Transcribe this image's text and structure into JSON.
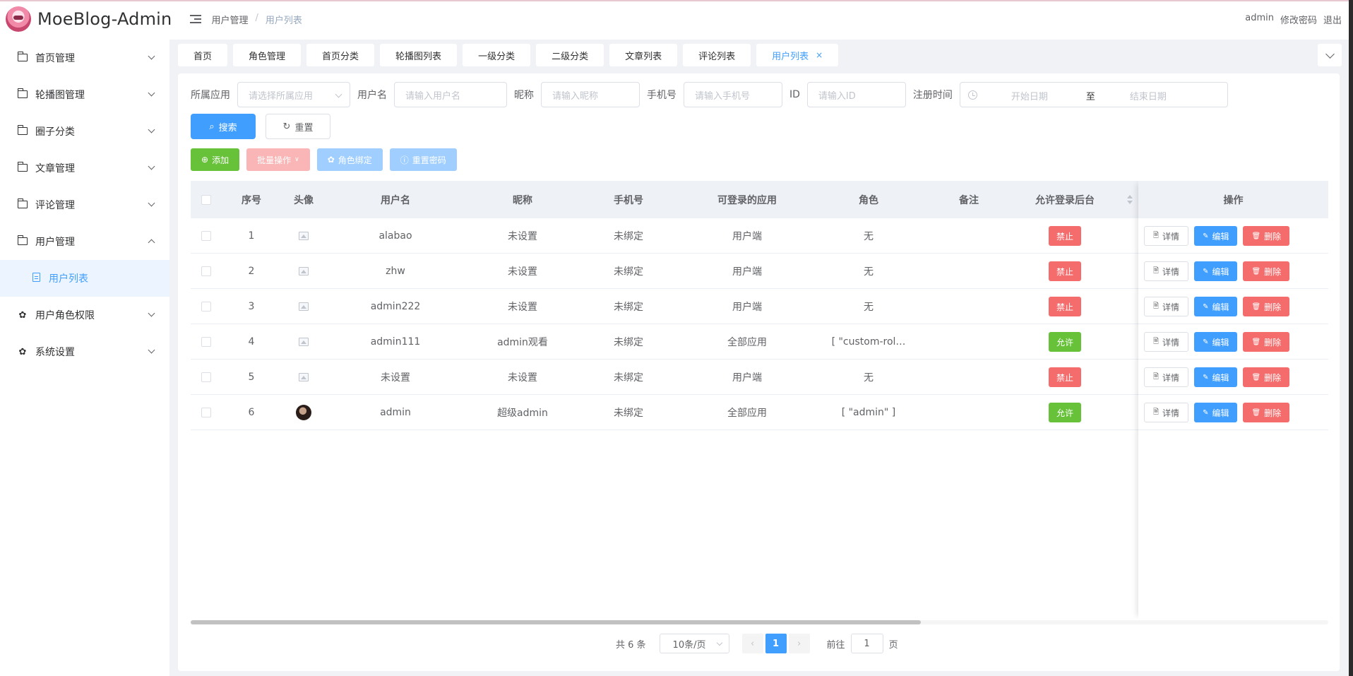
{
  "header": {
    "brand": "MoeBlog-Admin",
    "breadcrumb": [
      "用户管理",
      "用户列表"
    ],
    "user": "admin",
    "change_password": "修改密码",
    "logout": "退出"
  },
  "sidebar": {
    "items": [
      {
        "label": "首页管理",
        "icon": "folder-icon"
      },
      {
        "label": "轮播图管理",
        "icon": "folder-icon"
      },
      {
        "label": "圈子分类",
        "icon": "folder-icon"
      },
      {
        "label": "文章管理",
        "icon": "folder-icon"
      },
      {
        "label": "评论管理",
        "icon": "folder-icon"
      },
      {
        "label": "用户管理",
        "icon": "folder-icon",
        "expanded": true
      },
      {
        "label": "用户角色权限",
        "icon": "gear-icon"
      },
      {
        "label": "系统设置",
        "icon": "gear-icon"
      }
    ],
    "sub_item": "用户列表"
  },
  "tabs": [
    "首页",
    "角色管理",
    "首页分类",
    "轮播图列表",
    "一级分类",
    "二级分类",
    "文章列表",
    "评论列表",
    "用户列表"
  ],
  "active_tab": "用户列表",
  "search": {
    "app_label": "所属应用",
    "app_placeholder": "请选择所属应用",
    "username_label": "用户名",
    "username_placeholder": "请输入用户名",
    "nickname_label": "昵称",
    "nickname_placeholder": "请输入昵称",
    "phone_label": "手机号",
    "phone_placeholder": "请输入手机号",
    "id_label": "ID",
    "id_placeholder": "请输入ID",
    "regtime_label": "注册时间",
    "start_placeholder": "开始日期",
    "range_sep": "至",
    "end_placeholder": "结束日期",
    "search_btn": "搜索",
    "reset_btn": "重置"
  },
  "toolbar": {
    "add": "添加",
    "batch": "批量操作",
    "role_bind": "角色绑定",
    "reset_pwd": "重置密码"
  },
  "table": {
    "columns": [
      "序号",
      "头像",
      "用户名",
      "昵称",
      "手机号",
      "可登录的应用",
      "角色",
      "备注",
      "允许登录后台",
      "操作"
    ],
    "rows": [
      {
        "no": "1",
        "avatar": "image-placeholder",
        "username": "alabao",
        "nickname": "未设置",
        "phone": "未绑定",
        "app": "用户端",
        "role": "无",
        "remark": "",
        "status": "禁止",
        "allowed": false
      },
      {
        "no": "2",
        "avatar": "image-placeholder",
        "username": "zhw",
        "nickname": "未设置",
        "phone": "未绑定",
        "app": "用户端",
        "role": "无",
        "remark": "",
        "status": "禁止",
        "allowed": false
      },
      {
        "no": "3",
        "avatar": "image-placeholder",
        "username": "admin222",
        "nickname": "未设置",
        "phone": "未绑定",
        "app": "用户端",
        "role": "无",
        "remark": "",
        "status": "禁止",
        "allowed": false
      },
      {
        "no": "4",
        "avatar": "image-placeholder",
        "username": "admin111",
        "nickname": "admin观看",
        "phone": "未绑定",
        "app": "全部应用",
        "role": "[ \"custom-rol…",
        "remark": "",
        "status": "允许",
        "allowed": true
      },
      {
        "no": "5",
        "avatar": "image-placeholder",
        "username": "未设置",
        "nickname": "未设置",
        "phone": "未绑定",
        "app": "用户端",
        "role": "无",
        "remark": "",
        "status": "禁止",
        "allowed": false
      },
      {
        "no": "6",
        "avatar": "user-photo",
        "username": "admin",
        "nickname": "超级admin",
        "phone": "未绑定",
        "app": "全部应用",
        "role": "[ \"admin\" ]",
        "remark": "",
        "status": "允许",
        "allowed": true
      }
    ],
    "op_detail": "详情",
    "op_edit": "编辑",
    "op_delete": "删除"
  },
  "pagination": {
    "total": "共 6 条",
    "page_size": "10条/页",
    "current": "1",
    "goto_label": "前往",
    "goto_value": "1",
    "page_suffix": "页"
  },
  "colors": {
    "primary": "#409eff",
    "success": "#67c23a",
    "danger": "#f56c6c"
  }
}
